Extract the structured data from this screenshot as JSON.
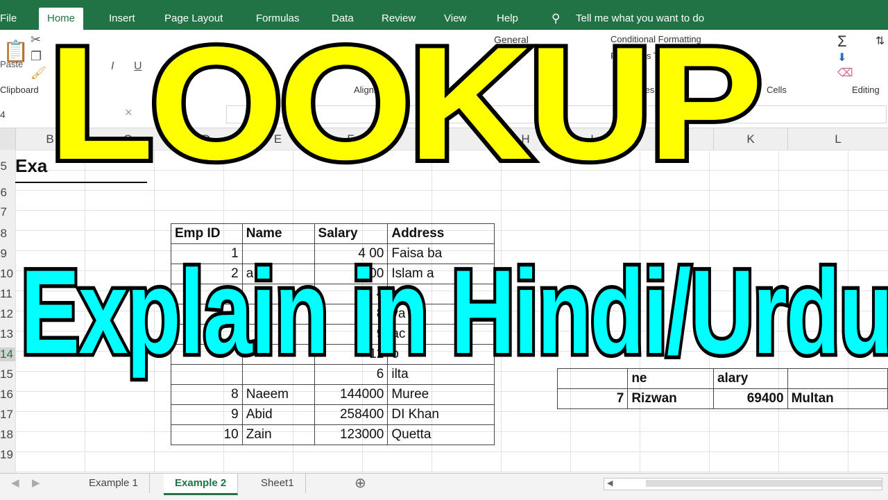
{
  "ribbon": {
    "tabs": [
      "File",
      "Home",
      "Insert",
      "Page Layout",
      "Formulas",
      "Data",
      "Review",
      "View",
      "Help"
    ],
    "tell_me": "Tell me what you want to do",
    "groups": {
      "clipboard": "Clipboard",
      "alignment": "Alignment",
      "styles": "Styles",
      "cells": "Cells",
      "editing": "Editing",
      "normal_fo": "Conditional Formatting",
      "as_table": "Format as Table",
      "general": "General",
      "paste": "Paste"
    }
  },
  "formula_bar": {
    "name_box": "4",
    "fx": "×"
  },
  "columns": [
    "B",
    "C",
    "D",
    "E",
    "F",
    "G",
    "H",
    "I",
    "J",
    "K",
    "L"
  ],
  "rows": [
    "5",
    "6",
    "7",
    "8",
    "9",
    "10",
    "11",
    "12",
    "13",
    "14",
    "15",
    "16",
    "17",
    "18",
    "19"
  ],
  "sheet": {
    "title": "Exa",
    "table_headers": [
      "Emp ID",
      "Name",
      "Salary",
      "Address"
    ],
    "table_rows": [
      [
        "1",
        "",
        "4 00",
        "Faisa ba"
      ],
      [
        "2",
        "a",
        "7 00",
        "Islam a"
      ],
      [
        "",
        "",
        "4",
        "sha"
      ],
      [
        "",
        "",
        "8",
        "va"
      ],
      [
        "",
        "",
        "9",
        "ac"
      ],
      [
        "",
        "",
        "12",
        "o"
      ],
      [
        "",
        "",
        "6",
        "ilta"
      ],
      [
        "8",
        "Naeem",
        "144000",
        "Muree"
      ],
      [
        "9",
        "Abid",
        "258400",
        "DI Khan"
      ],
      [
        "10",
        "Zain",
        "123000",
        "Quetta"
      ]
    ],
    "result_headers": [
      "",
      "ne",
      "alary",
      ""
    ],
    "result_row": [
      "7",
      "Rizwan",
      "69400",
      "Multan"
    ],
    "side_label": "s"
  },
  "sheet_tabs": [
    "Example 1",
    "Example 2",
    "Sheet1"
  ],
  "overlay": {
    "line1": "LOOKUP",
    "line2": "Explain in Hindi/Urdu"
  },
  "colors": {
    "excel_green": "#217346",
    "overlay_yellow": "#ffff00",
    "overlay_cyan": "#00ffff"
  }
}
